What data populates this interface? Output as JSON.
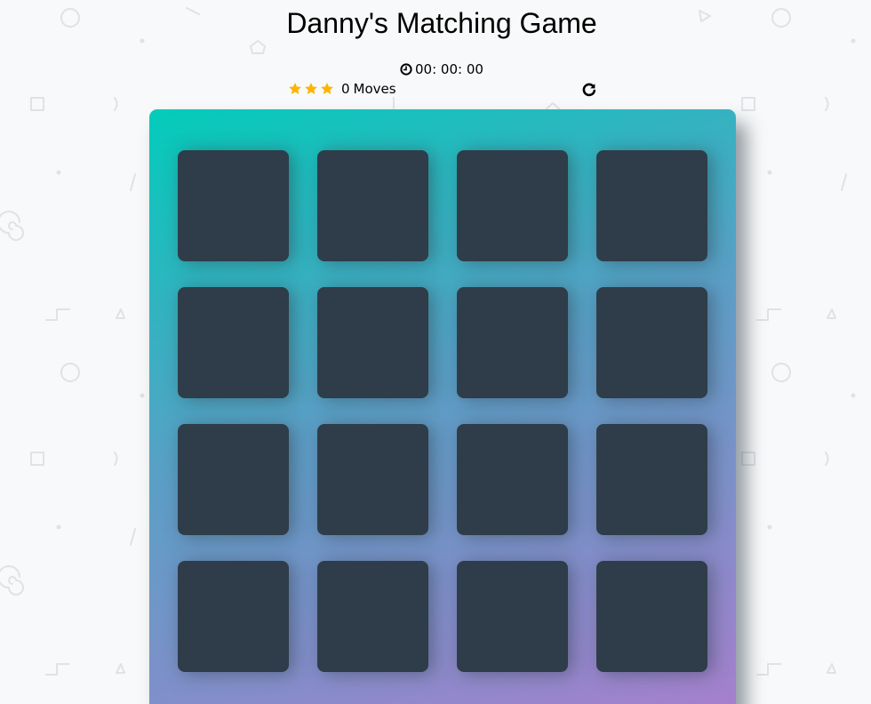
{
  "page": {
    "title": "Danny's Matching Game"
  },
  "timer": {
    "icon": "clock-icon",
    "display": "00: 00: 00"
  },
  "score": {
    "star_count": 3,
    "star_color": "#ffb400",
    "moves_count": "0",
    "moves_label": "Moves"
  },
  "restart": {
    "icon": "repeat-icon"
  },
  "deck": {
    "gradient_colors": [
      "#02ccba",
      "#aa7ecd"
    ],
    "card_color": "#2e3d49",
    "cards": [
      {
        "state": "face-down"
      },
      {
        "state": "face-down"
      },
      {
        "state": "face-down"
      },
      {
        "state": "face-down"
      },
      {
        "state": "face-down"
      },
      {
        "state": "face-down"
      },
      {
        "state": "face-down"
      },
      {
        "state": "face-down"
      },
      {
        "state": "face-down"
      },
      {
        "state": "face-down"
      },
      {
        "state": "face-down"
      },
      {
        "state": "face-down"
      },
      {
        "state": "face-down"
      },
      {
        "state": "face-down"
      },
      {
        "state": "face-down"
      },
      {
        "state": "face-down"
      }
    ]
  }
}
